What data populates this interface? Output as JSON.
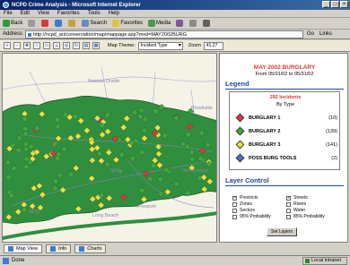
{
  "window": {
    "title": "NCPD Crime Analysis - Microsoft Internet Explorer",
    "controls": [
      "_",
      "□",
      "×"
    ]
  },
  "menu": [
    "File",
    "Edit",
    "View",
    "Favorites",
    "Tools",
    "Help"
  ],
  "toolbar": {
    "back": "Back",
    "search": "Search",
    "favorites": "Favorites",
    "media": "Media"
  },
  "address": {
    "label": "Address",
    "url": "http://ncpd_ari/conservation/map/mappage.asp?mxd=MAY2002BURG",
    "go": "Go",
    "links": "Links"
  },
  "map_toolbar": {
    "theme_label": "Map Theme:",
    "theme_value": "Incident Type",
    "zoom_label": "Zoom",
    "zoom_value": "41.27"
  },
  "map": {
    "places": [
      "Nassau Divide",
      "Brookville",
      "Hempstead",
      "Freeport",
      "Long Beach",
      "M00",
      "M10"
    ]
  },
  "report": {
    "title": "MAY 2002 BURGLARY",
    "date_range": "From 05/01/02 to 05/31/02"
  },
  "legend": {
    "heading": "Legend",
    "incidents_title": "292 Incidents",
    "by_type": "By Type",
    "items": [
      {
        "label": "BURGLARY 1",
        "count": "(10)",
        "color": "#d83a3a"
      },
      {
        "label": "BURGLARY 2",
        "count": "(139)",
        "color": "#3cab3c"
      },
      {
        "label": "BURGLARY 3",
        "count": "(141)",
        "color": "#e8e23c"
      },
      {
        "label": "POSS BURG TOOLS",
        "count": "(2)",
        "color": "#4a6ad8"
      }
    ]
  },
  "layer_control": {
    "heading": "Layer Control",
    "left": [
      {
        "label": "Precincts",
        "checked": true
      },
      {
        "label": "Zones",
        "checked": false
      },
      {
        "label": "Sectors",
        "checked": false
      },
      {
        "label": "95% Probability",
        "checked": false
      }
    ],
    "right": [
      {
        "label": "Streets",
        "checked": true
      },
      {
        "label": "Rivers",
        "checked": false
      },
      {
        "label": "Water",
        "checked": false
      },
      {
        "label": "85% Probability",
        "checked": false
      }
    ],
    "set_button": "Set Layers"
  },
  "tabs": [
    {
      "label": "Map View",
      "active": true
    },
    {
      "label": "Info",
      "active": false
    },
    {
      "label": "Charts",
      "active": false
    }
  ],
  "status": {
    "text": "Done",
    "zone": "Local intranet"
  }
}
